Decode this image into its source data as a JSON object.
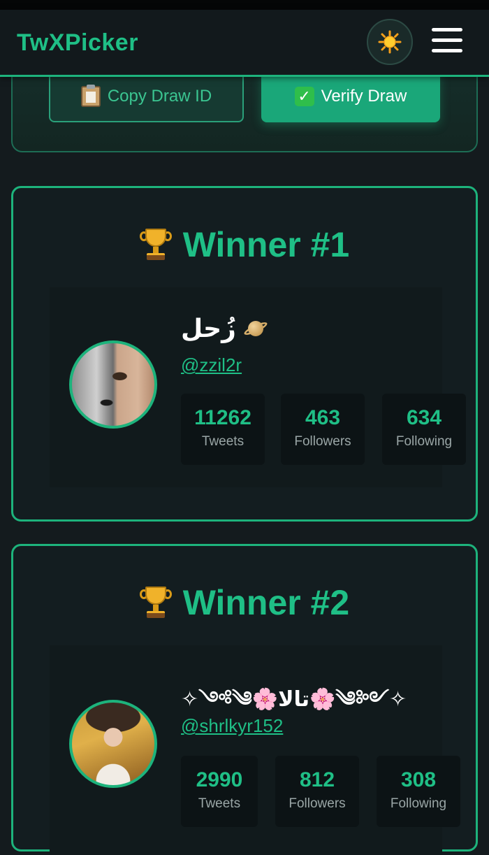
{
  "header": {
    "brand": "TwXPicker",
    "theme_icon": "sun-icon",
    "menu_icon": "hamburger-menu-icon"
  },
  "actions": {
    "copy_label": "Copy Draw ID",
    "copy_icon": "clipboard-icon",
    "verify_label": "Verify Draw",
    "verify_icon": "check-mark-icon"
  },
  "colors": {
    "accent": "#1fbf86",
    "background": "#141b1e",
    "card": "#131d20"
  },
  "winners": [
    {
      "title": "Winner #1",
      "name": "زُحل",
      "name_icon": "ringed-planet-icon",
      "handle": "@zzil2r",
      "stats": [
        {
          "value": "11262",
          "label": "Tweets"
        },
        {
          "value": "463",
          "label": "Followers"
        },
        {
          "value": "634",
          "label": "Following"
        }
      ]
    },
    {
      "title": "Winner #2",
      "name": "✧༺༄🌸تالا🌸༄༻✧",
      "handle": "@shrlkyr152",
      "stats": [
        {
          "value": "2990",
          "label": "Tweets"
        },
        {
          "value": "812",
          "label": "Followers"
        },
        {
          "value": "308",
          "label": "Following"
        }
      ]
    }
  ]
}
